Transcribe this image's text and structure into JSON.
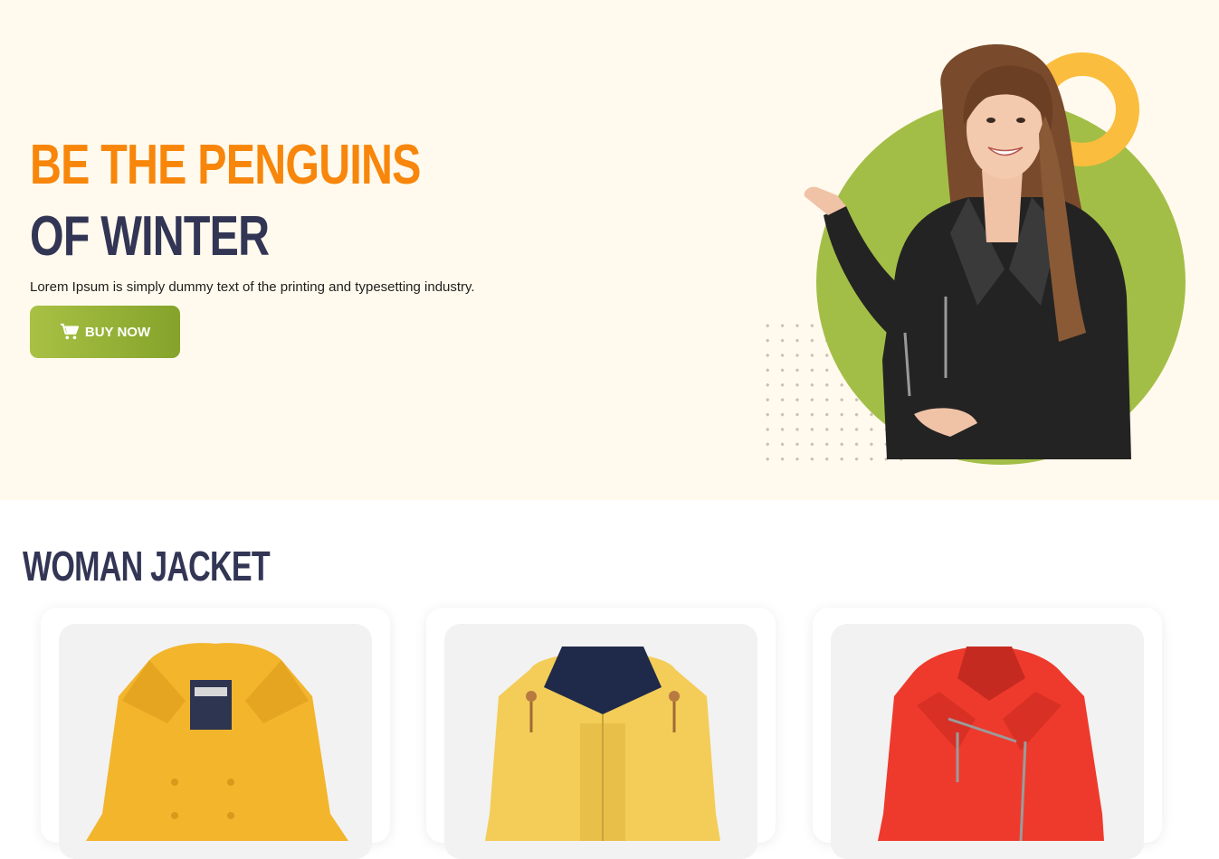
{
  "hero": {
    "title_line1": "BE THE PENGUINS",
    "title_line2": "OF WINTER",
    "subtitle": "Lorem Ipsum is simply dummy text of the printing and typesetting industry.",
    "buy_label": "BUY NOW",
    "buy_icon": "cart-icon"
  },
  "section": {
    "title": "WOMAN JACKET"
  },
  "products": [
    {
      "name": "yellow trench coat",
      "color": "#f2b52c"
    },
    {
      "name": "yellow hooded rain jacket",
      "color": "#f3cd58"
    },
    {
      "name": "red leather biker jacket",
      "color": "#ee3a2c"
    }
  ],
  "colors": {
    "hero_bg": "#fffaed",
    "accent_orange": "#f7860b",
    "navy": "#323554",
    "button_green": "#8fae33",
    "circle_green": "#a3be46",
    "ring_yellow": "#fbbd3d"
  }
}
